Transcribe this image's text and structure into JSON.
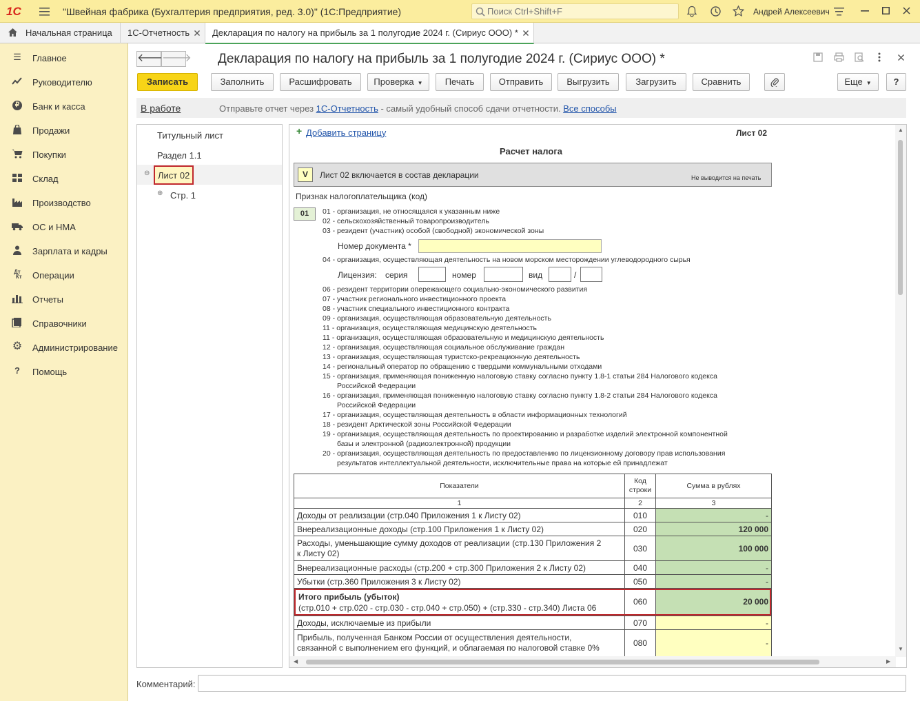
{
  "app": {
    "title": "\"Швейная фабрика (Бухгалтерия предприятия, ред. 3.0)\"  (1С:Предприятие)",
    "logo": "1С",
    "search_placeholder": "Поиск Ctrl+Shift+F",
    "user": "Андрей Алексеевич"
  },
  "tabs": [
    {
      "label": "Начальная страница",
      "icon": "home-icon"
    },
    {
      "label": "1С-Отчетность"
    },
    {
      "label": "Декларация по налогу на прибыль за 1 полугодие 2024 г. (Сириус ООО) *",
      "active": true
    }
  ],
  "sidebar": {
    "items": [
      {
        "label": "Главное",
        "icon": "menu-icon"
      },
      {
        "label": "Руководителю",
        "icon": "chart-line-icon"
      },
      {
        "label": "Банк и касса",
        "icon": "ruble-icon"
      },
      {
        "label": "Продажи",
        "icon": "bag-icon"
      },
      {
        "label": "Покупки",
        "icon": "cart-icon"
      },
      {
        "label": "Склад",
        "icon": "warehouse-icon"
      },
      {
        "label": "Производство",
        "icon": "factory-icon"
      },
      {
        "label": "ОС и НМА",
        "icon": "truck-icon"
      },
      {
        "label": "Зарплата и кадры",
        "icon": "person-icon"
      },
      {
        "label": "Операции",
        "icon": "debit-credit-icon"
      },
      {
        "label": "Отчеты",
        "icon": "bar-chart-icon"
      },
      {
        "label": "Справочники",
        "icon": "book-icon"
      },
      {
        "label": "Администрирование",
        "icon": "gear-icon"
      },
      {
        "label": "Помощь",
        "icon": "question-icon"
      }
    ]
  },
  "document": {
    "title": "Декларация по налогу на прибыль за 1 полугодие 2024 г. (Сириус ООО) *",
    "toolbar": {
      "save": "Записать",
      "fill": "Заполнить",
      "decode": "Расшифровать",
      "check": "Проверка",
      "print": "Печать",
      "send": "Отправить",
      "export": "Выгрузить",
      "import": "Загрузить",
      "compare": "Сравнить",
      "more": "Еще",
      "help": "?"
    },
    "status": "В работе",
    "info": {
      "prefix": "Отправьте отчет через ",
      "link1": "1С-Отчетность",
      "middle": " - самый удобный способ сдачи отчетности. ",
      "link2": "Все способы"
    },
    "tree": {
      "title_page": "Титульный лист",
      "section": "Раздел 1.1",
      "sheet": "Лист 02",
      "page": "Стр. 1"
    },
    "comment_label": "Комментарий:"
  },
  "sheet": {
    "add_page": "Добавить страницу",
    "sheet_label": "Лист 02",
    "heading": "Расчет налога",
    "included_mark": "V",
    "included_text": "Лист 02 включается в состав декларации",
    "no_print": "Не выводится на печать",
    "taxpayer_sign": "Признак налогоплательщика (код)",
    "taxpayer_code": "01",
    "codes": [
      "01 - организация, не относящаяся к указанным ниже",
      "02 - сельскохозяйственный товаропроизводитель",
      "03 - резидент (участник) особой (свободной) экономической зоны",
      "04 - организация, осуществляющая деятельность на новом морском месторождении углеводородного сырья",
      "06 - резидент территории опережающего социально-экономического развития",
      "07 - участник регионального инвестиционного проекта",
      "08 - участник специального инвестиционного контракта",
      "09 - организация, осуществляющая образовательную деятельность",
      "11 - организация, осуществляющая медицинскую деятельность",
      "11 - организация, осуществляющая образовательную и медицинскую деятельность",
      "12 - организация, осуществляющая социальное обслуживание граждан",
      "13 - организация, осуществляющая туристско-рекреационную деятельность",
      "14 - региональный оператор по обращению с твердыми коммунальными отходами",
      "15 - организация, применяющая пониженную налоговую ставку согласно пункту 1.8-1 статьи 284 Налогового кодекса",
      "Российской Федерации",
      "16 - организация, применяющая пониженную налоговую ставку согласно пункту 1.8-2 статьи 284 Налогового кодекса",
      "Российской Федерации",
      "17 - организация, осуществляющая деятельность в области информационных технологий",
      "18 - резидент Арктической зоны Российской Федерации",
      "19 - организация, осуществляющая деятельность по проектированию и разработке изделий электронной компонентной",
      "базы и электронной (радиоэлектронной) продукции",
      "20 - организация, осуществляющая деятельность по предоставлению по лицензионному договору прав использования",
      "результатов интеллектуальной деятельности, исключительные права на которые ей принадлежат"
    ],
    "doc_number_label": "Номер документа *",
    "license_label": "Лицензия:",
    "series_label": "серия",
    "number_label": "номер",
    "kind_label": "вид",
    "slash": "/",
    "table": {
      "headers": [
        "Показатели",
        "Код строки",
        "Сумма в рублях"
      ],
      "header_nums": [
        "1",
        "2",
        "3"
      ],
      "rows": [
        {
          "label": "Доходы от реализации (стр.040 Приложения 1 к Листу 02)",
          "code": "010",
          "sum": "-"
        },
        {
          "label": "Внереализационные доходы (стр.100 Приложения 1 к Листу 02)",
          "code": "020",
          "sum": "120 000"
        },
        {
          "label": "Расходы, уменьшающие сумму доходов от реализации (стр.130 Приложения 2",
          "label2": "к Листу 02)",
          "code": "030",
          "sum": "100 000"
        },
        {
          "label": "Внереализационные расходы (стр.200 + стр.300 Приложения 2 к Листу 02)",
          "code": "040",
          "sum": "-"
        },
        {
          "label": "Убытки (стр.360 Приложения 3 к Листу 02)",
          "code": "050",
          "sum": "-"
        },
        {
          "label": "Итого прибыль (убыток)",
          "label2": "(стр.010 + стр.020 - стр.030 - стр.040 + стр.050) + (стр.330 - стр.340) Листа 06",
          "code": "060",
          "sum": "20 000"
        },
        {
          "label": "Доходы, исключаемые из прибыли",
          "code": "070",
          "sum": "-"
        },
        {
          "label": "Прибыль, полученная Банком России от осуществления деятельности,",
          "label2": "связанной с выполнением его функций, и облагаемая по налоговой ставке 0%",
          "code": "080",
          "sum": "-"
        }
      ]
    }
  },
  "colors": {
    "titlebar": "#fbed9e",
    "sidebar": "#fbf1c3",
    "primary_button": "#f7d417",
    "green_cell": "#c5e0b4",
    "yellow_cell": "#ffffc0",
    "highlight_border": "#c0282d",
    "link": "#2255aa"
  }
}
